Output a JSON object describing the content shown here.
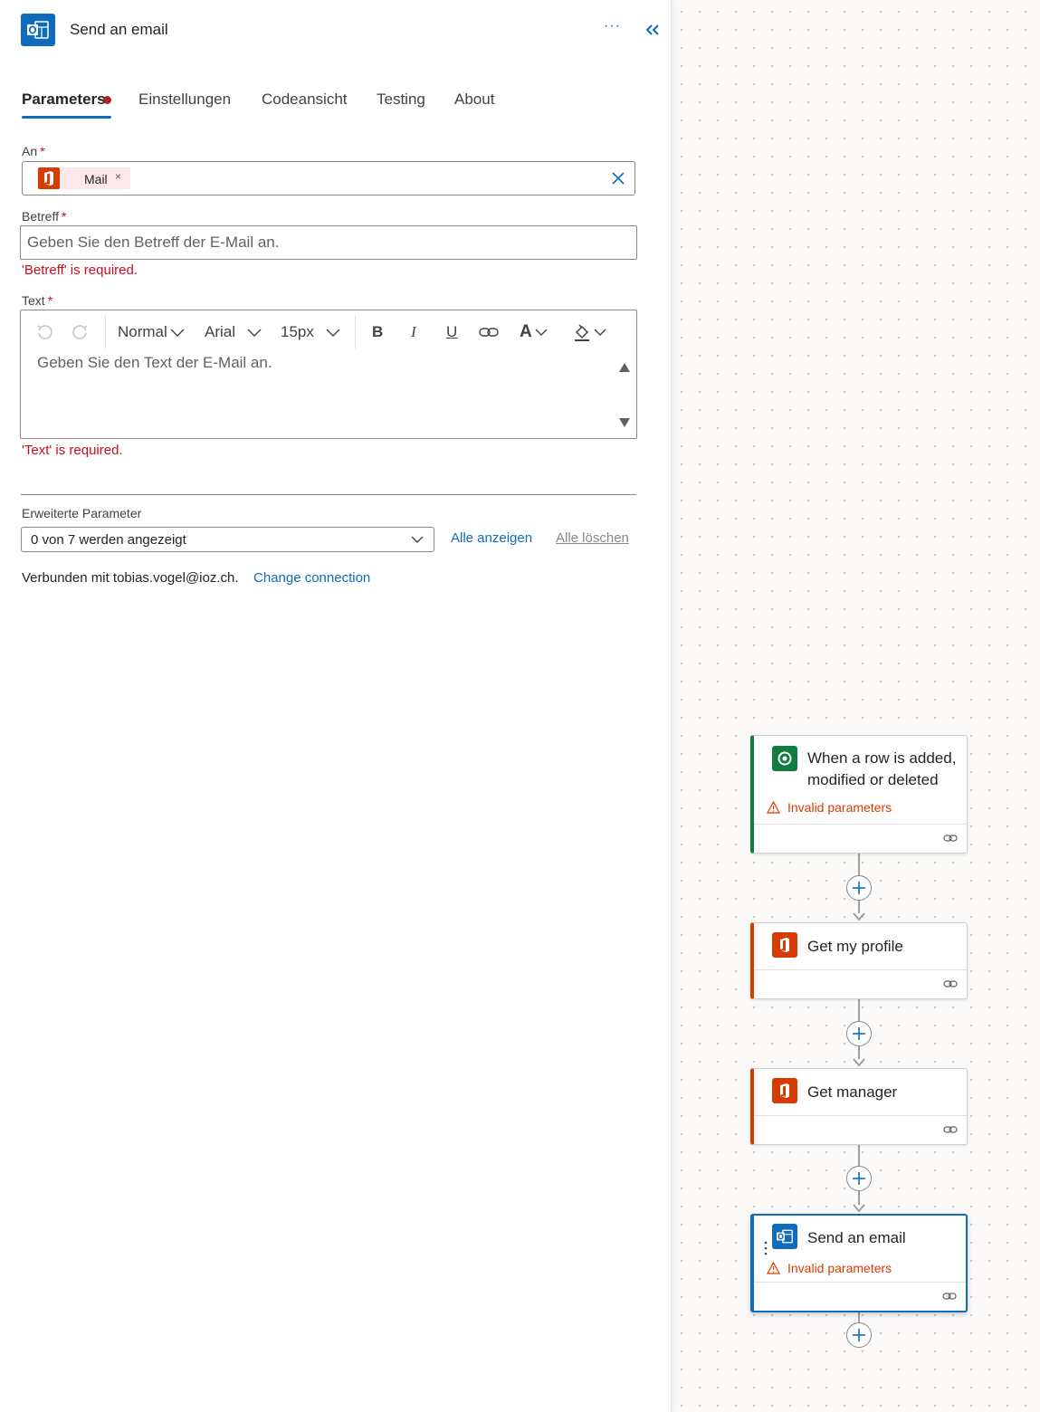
{
  "panel": {
    "title": "Send an email",
    "more_label": "···",
    "tabs": [
      {
        "label": "Parameters",
        "active": true
      },
      {
        "label": "Einstellungen"
      },
      {
        "label": "Codeansicht"
      },
      {
        "label": "Testing"
      },
      {
        "label": "About"
      }
    ],
    "to": {
      "label": "An",
      "required_mark": "*",
      "token_label": "Mail",
      "token_remove": "×"
    },
    "subject": {
      "label": "Betreff",
      "required_mark": "*",
      "placeholder": "Geben Sie den Betreff der E-Mail an.",
      "error": "'Betreff' is required."
    },
    "body": {
      "label": "Text",
      "required_mark": "*",
      "placeholder": "Geben Sie den Text der E-Mail an.",
      "error": "'Text' is required.",
      "toolbar": {
        "format": "Normal",
        "font": "Arial",
        "size": "15px",
        "bold": "B",
        "italic": "I",
        "underline": "U",
        "font_color": "A"
      }
    },
    "advanced": {
      "label": "Erweiterte Parameter",
      "select_value": "0 von 7 werden angezeigt",
      "show_all": "Alle anzeigen",
      "clear_all": "Alle löschen"
    },
    "connection": {
      "text": "Verbunden mit tobias.vogel@ioz.ch.",
      "change_link": "Change connection"
    }
  },
  "flow": {
    "cards": [
      {
        "title_line1": "When a row is added,",
        "title_line2": "modified or deleted",
        "warning": "Invalid parameters",
        "accent": "#107c41"
      },
      {
        "title": "Get my profile",
        "accent": "#d83b01"
      },
      {
        "title": "Get manager",
        "accent": "#d83b01"
      },
      {
        "title": "Send an email",
        "warning": "Invalid parameters",
        "accent": "#0f6cbd",
        "selected": true
      }
    ]
  },
  "colors": {
    "brand": "#0f6cbd",
    "error": "#c50f1f",
    "warning": "#d83b01",
    "office": "#d83b01",
    "dataverse": "#107c41"
  }
}
